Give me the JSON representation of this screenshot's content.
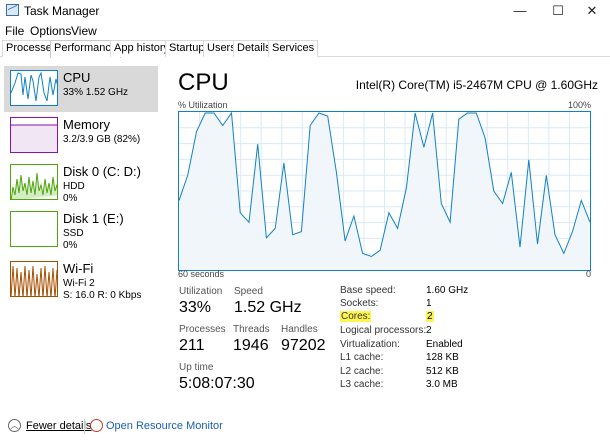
{
  "window": {
    "title": "Task Manager",
    "minimize": "—",
    "maximize": "☐",
    "close": "✕"
  },
  "menu": [
    "File",
    "Options",
    "View"
  ],
  "tabs": [
    "Processes",
    "Performance",
    "App history",
    "Startup",
    "Users",
    "Details",
    "Services"
  ],
  "sidebar": {
    "cpu": {
      "title": "CPU",
      "sub": "33% 1.52 GHz"
    },
    "memory": {
      "title": "Memory",
      "sub": "3.2/3.9 GB (82%)"
    },
    "disk0": {
      "title": "Disk 0 (C: D:)",
      "type": "HDD",
      "usage": "0%"
    },
    "disk1": {
      "title": "Disk 1 (E:)",
      "type": "SSD",
      "usage": "0%"
    },
    "wifi": {
      "title": "Wi-Fi",
      "name": "Wi-Fi 2",
      "rate": "S: 16.0  R: 0 Kbps"
    }
  },
  "main": {
    "title": "CPU",
    "model": "Intel(R) Core(TM) i5-2467M CPU @ 1.60GHz",
    "graph": {
      "ylabel": "% Utilization",
      "ymax_label": "100%",
      "xlabel": "60 seconds",
      "xmin_label": "0",
      "values": [
        44,
        60,
        88,
        100,
        100,
        92,
        100,
        36,
        30,
        80,
        20,
        26,
        68,
        22,
        24,
        92,
        100,
        98,
        62,
        18,
        34,
        10,
        8,
        12,
        36,
        26,
        52,
        100,
        78,
        100,
        42,
        30,
        96,
        100,
        100,
        84,
        50,
        42,
        62,
        14,
        70,
        16,
        60,
        22,
        10,
        24,
        44,
        30
      ]
    },
    "stats": {
      "utilization": {
        "label": "Utilization",
        "value": "33%"
      },
      "speed": {
        "label": "Speed",
        "value": "1.52 GHz"
      },
      "processes": {
        "label": "Processes",
        "value": "211"
      },
      "threads": {
        "label": "Threads",
        "value": "1946"
      },
      "handles": {
        "label": "Handles",
        "value": "97202"
      },
      "uptime": {
        "label": "Up time",
        "value": "5:08:07:30"
      }
    },
    "info": [
      {
        "label": "Base speed:",
        "value": "1.60 GHz"
      },
      {
        "label": "Sockets:",
        "value": "1"
      },
      {
        "label": "Cores:",
        "value": "2"
      },
      {
        "label": "Logical processors:",
        "value": "2"
      },
      {
        "label": "Virtualization:",
        "value": "Enabled"
      },
      {
        "label": "L1 cache:",
        "value": "128 KB"
      },
      {
        "label": "L2 cache:",
        "value": "512 KB"
      },
      {
        "label": "L3 cache:",
        "value": "3.0 MB"
      }
    ]
  },
  "footer": {
    "fewer_details": "Fewer details",
    "resource_monitor": "Open Resource Monitor"
  },
  "colors": {
    "cpu": "#1181c4",
    "cpu_fill": "#f1f6fa",
    "memory": "#8b12ae",
    "disk": "#4da60c",
    "wifi": "#a74f01",
    "highlight": "#fff64d"
  },
  "icons": {
    "app": "task-manager-icon",
    "fewer": "chevron-up-icon",
    "monitor": "resource-monitor-icon"
  }
}
